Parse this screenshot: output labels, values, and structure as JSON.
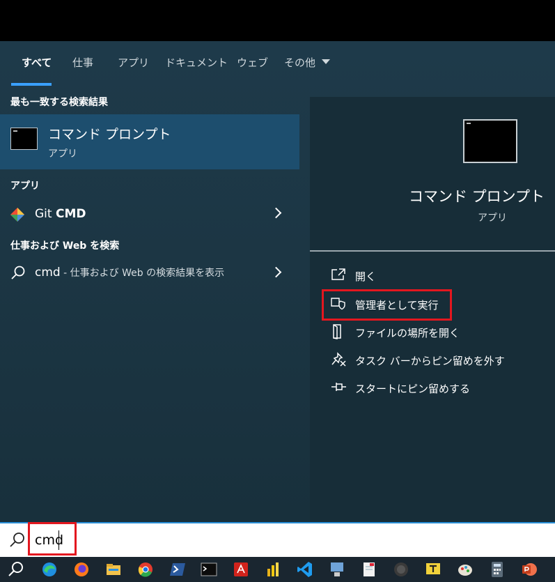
{
  "tabs": [
    {
      "label": "すべて"
    },
    {
      "label": "仕事"
    },
    {
      "label": "アプリ"
    },
    {
      "label": "ドキュメント"
    },
    {
      "label": "ウェブ"
    },
    {
      "label": "その他"
    }
  ],
  "left": {
    "best_match_title": "最も一致する検索結果",
    "best_match": {
      "name": "コマンド プロンプト",
      "type": "アプリ"
    },
    "apps_title": "アプリ",
    "app_item": {
      "prefix": "Git ",
      "bold": "CMD"
    },
    "web_title": "仕事および Web を検索",
    "web_item": {
      "query": "cmd",
      "suffix": " - 仕事および Web の検索結果を表示"
    }
  },
  "right": {
    "app_name": "コマンド プロンプト",
    "app_type": "アプリ",
    "actions": [
      {
        "label": "開く",
        "icon": "open-icon"
      },
      {
        "label": "管理者として実行",
        "icon": "shield-icon"
      },
      {
        "label": "ファイルの場所を開く",
        "icon": "file-location-icon"
      },
      {
        "label": "タスク バーからピン留めを外す",
        "icon": "unpin-icon"
      },
      {
        "label": "スタートにピン留めする",
        "icon": "pin-icon"
      }
    ]
  },
  "search": {
    "value": "cmd"
  },
  "colors": {
    "highlight": "#e3171f",
    "accent": "#3aa0ff",
    "selected": "#1d4e6e"
  },
  "taskbar": [
    "search-icon",
    "edge-icon",
    "firefox-icon",
    "file-explorer-icon",
    "chrome-icon",
    "powershell-icon",
    "terminal-icon",
    "acrobat-icon",
    "powerbi-icon",
    "vscode-icon",
    "network-icon",
    "notepad-icon",
    "obs-icon",
    "tera-term-icon",
    "paint-icon",
    "calculator-icon",
    "powerpoint-icon"
  ]
}
